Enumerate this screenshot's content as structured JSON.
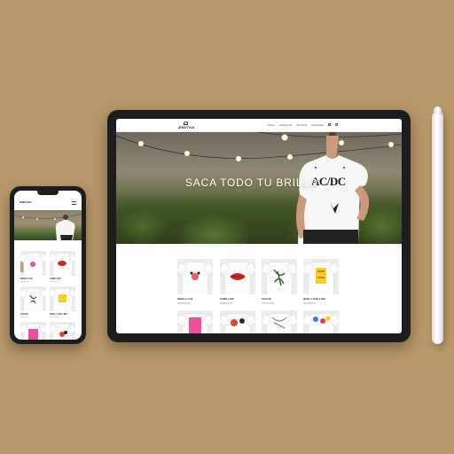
{
  "site": {
    "logo_text": "ÆMOTIVA",
    "nav": [
      "Home",
      "Categorías",
      "Contacto",
      "Registrate"
    ],
    "hero_title": "SACA TODO TU BRILLO",
    "hero_shirt_text": "AC/DC",
    "products_row1": [
      {
        "name": "EMOLA CAT",
        "graphic": "cat-hands",
        "color": "#e35c74"
      },
      {
        "name": "FAME LIPS",
        "graphic": "lips",
        "color": "#c9262d"
      },
      {
        "name": "VOGUE",
        "graphic": "leaves",
        "color": "#2f5a2c"
      },
      {
        "name": "NOEL LOVE LIKE",
        "graphic": "love-text",
        "color": "#f2d21b"
      }
    ],
    "products_row2": [
      {
        "graphic": "pink-number",
        "color": "#ec4f9b"
      },
      {
        "graphic": "flower",
        "color": "#e0452f"
      },
      {
        "graphic": "sketch",
        "color": "#555555"
      },
      {
        "graphic": "floral-print",
        "color": "#3f7bd4"
      }
    ],
    "phone_products": [
      {
        "name": "EMOLA CAT",
        "color": "#e35c74"
      },
      {
        "name": "FAME LIPS",
        "color": "#c9262d"
      },
      {
        "name": "VOGUE",
        "color": "#2f5a2c"
      },
      {
        "name": "NOEL LOVE LIKE",
        "color": "#f2d21b"
      },
      {
        "color": "#ec4f9b"
      },
      {
        "color": "#e0452f"
      }
    ]
  },
  "colors": {
    "background": "#b8986a",
    "device_frame": "#1d1d1f",
    "pencil": "#f3f3f3"
  }
}
